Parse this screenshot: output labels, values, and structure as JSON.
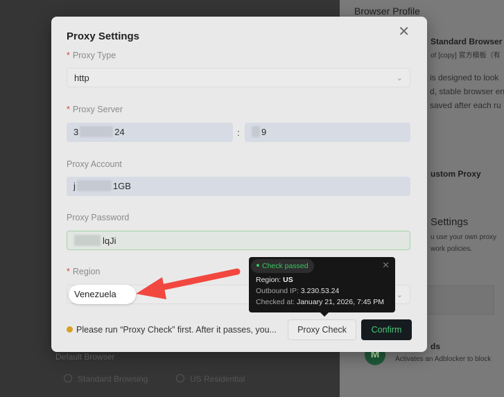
{
  "background": {
    "browser_profile_title": "Browser Profile",
    "standard_browser": "Standard Browser",
    "standard_browser_sub": "of [copy] 官方模板（有",
    "description_lines": [
      "is designed to look",
      "d, stable browser en",
      "saved after each ru"
    ],
    "custom_proxy": "ustom Proxy",
    "settings_title": "Settings",
    "settings_sub_lines": [
      "u use your own proxy",
      "work policies."
    ],
    "ds_label": "ds",
    "adblock_text": "Activates an Adblocker to block",
    "default_browser": "Default Browser",
    "chip_standard": "Standard Browsing",
    "chip_residential": "US Residential"
  },
  "modal": {
    "title": "Proxy Settings",
    "close_icon": "close-icon",
    "proxy_type": {
      "label": "Proxy Type",
      "value": "http",
      "required": true
    },
    "proxy_server": {
      "label": "Proxy Server",
      "host_start": "3",
      "host_end": "24",
      "separator": ":",
      "port_end": "9",
      "required": true
    },
    "proxy_account": {
      "label": "Proxy Account",
      "value_start": "j",
      "value_end": "1GB"
    },
    "proxy_password": {
      "label": "Proxy Password",
      "value_end": "lqJi"
    },
    "region": {
      "label": "Region",
      "required": true
    },
    "warning": "Please run “Proxy Check” first. After it passes, you...",
    "proxy_check_button": "Proxy Check",
    "confirm_button": "Confirm"
  },
  "tooltip": {
    "status": "Check passed",
    "region_label": "Region:",
    "region_value": "US",
    "outbound_label": "Outbound IP:",
    "outbound_value": "3.230.53.24",
    "checked_label": "Checked at:",
    "checked_value": "January 21, 2026, 7:45 PM"
  },
  "annotation": {
    "region_highlight": "Venezuela",
    "arrow_color": "#f2473f"
  },
  "colors": {
    "confirm_bg": "#151b1f",
    "confirm_text": "#4ec879",
    "success": "#37c760",
    "required": "#d24a3c",
    "warning_dot": "#d7a020"
  }
}
